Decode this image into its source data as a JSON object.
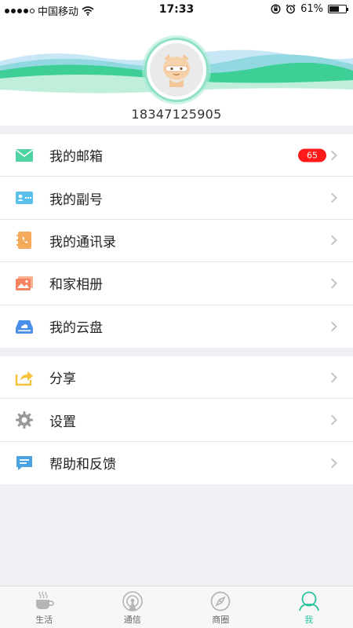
{
  "status_bar": {
    "carrier": "中国移动",
    "time": "17:33",
    "battery": "61%",
    "battery_level": 0.61
  },
  "profile": {
    "phone": "18347125905"
  },
  "menu_groups": [
    {
      "items": [
        {
          "label": "我的邮箱",
          "icon": "mail-icon",
          "badge": "65",
          "color": "#4fd3a3"
        },
        {
          "label": "我的副号",
          "icon": "id-card-icon",
          "color": "#5bc0e8"
        },
        {
          "label": "我的通讯录",
          "icon": "contacts-book-icon",
          "color": "#f5a95a"
        },
        {
          "label": "和家相册",
          "icon": "photo-album-icon",
          "color": "#f4845f"
        },
        {
          "label": "我的云盘",
          "icon": "cloud-drive-icon",
          "color": "#4a8fe7"
        }
      ]
    },
    {
      "items": [
        {
          "label": "分享",
          "icon": "share-icon",
          "color": "#f5c23a"
        },
        {
          "label": "设置",
          "icon": "gear-icon",
          "color": "#999999"
        },
        {
          "label": "帮助和反馈",
          "icon": "feedback-icon",
          "color": "#4aa3e0"
        }
      ]
    }
  ],
  "tabbar": {
    "tabs": [
      {
        "label": "生活",
        "icon": "coffee-cup-icon",
        "active": false
      },
      {
        "label": "通信",
        "icon": "antenna-icon",
        "active": false
      },
      {
        "label": "商圈",
        "icon": "compass-icon",
        "active": false
      },
      {
        "label": "我",
        "icon": "user-icon",
        "active": true
      }
    ]
  },
  "colors": {
    "accent": "#2cc3a3",
    "badge": "#ff1a1a",
    "background": "#efeff4"
  }
}
